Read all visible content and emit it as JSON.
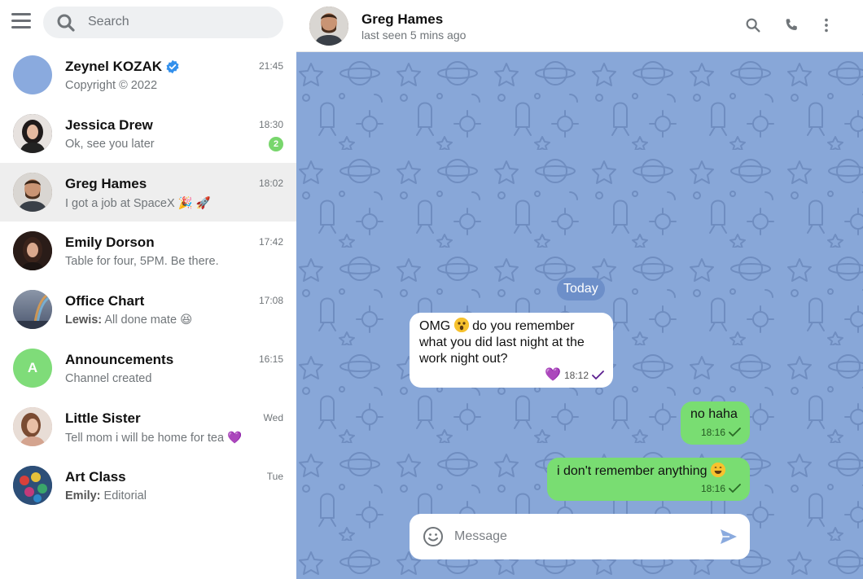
{
  "search": {
    "placeholder": "Search"
  },
  "chats": [
    {
      "name": "Zeynel KOZAK",
      "verified": true,
      "time": "21:45",
      "preview": "Copyright © 2022",
      "avatar_color": "#8aaade"
    },
    {
      "name": "Jessica Drew",
      "time": "18:30",
      "preview": "Ok, see you later",
      "unread": "2",
      "avatar_color": "#3d3a3a"
    },
    {
      "name": "Greg Hames",
      "time": "18:02",
      "preview": "I got a job at SpaceX",
      "preview_emoji": "🎉 🚀",
      "active": true,
      "avatar_color": "#7a5a45"
    },
    {
      "name": "Emily Dorson",
      "time": "17:42",
      "preview": "Table for four, 5PM. Be there.",
      "avatar_color": "#4a2e26"
    },
    {
      "name": "Office Chart",
      "time": "17:08",
      "sender": "Lewis:",
      "preview": "All done mate",
      "preview_emoji": "😆",
      "avatar_color": "#5b6b84"
    },
    {
      "name": "Announcements",
      "time": "16:15",
      "preview": "Channel created",
      "avatar_letter": "A",
      "avatar_color": "#7fdc79"
    },
    {
      "name": "Little Sister",
      "time": "Wed",
      "preview": "Tell mom i will be home for tea",
      "preview_emoji": "💜",
      "avatar_color": "#c99a86"
    },
    {
      "name": "Art Class",
      "time": "Tue",
      "sender": "Emily:",
      "preview": "Editorial",
      "avatar_color": "#2d4f78"
    }
  ],
  "header": {
    "name": "Greg Hames",
    "status": "last seen 5 mins ago"
  },
  "conversation": {
    "date_label": "Today",
    "messages": [
      {
        "dir": "in",
        "text_before": "OMG",
        "text_after": "do you remember what you did last night at the work night out?",
        "time": "18:12",
        "reaction": "💜"
      },
      {
        "dir": "out",
        "text": "no haha",
        "time": "18:16"
      },
      {
        "dir": "out",
        "text": "i don't remember anything",
        "time": "18:16"
      }
    ]
  },
  "composer": {
    "placeholder": "Message"
  },
  "colors": {
    "chat_bg": "#88a7d8",
    "outgoing": "#79dd72",
    "date_pill": "#6d8fc9",
    "badge": "#78d66c"
  }
}
